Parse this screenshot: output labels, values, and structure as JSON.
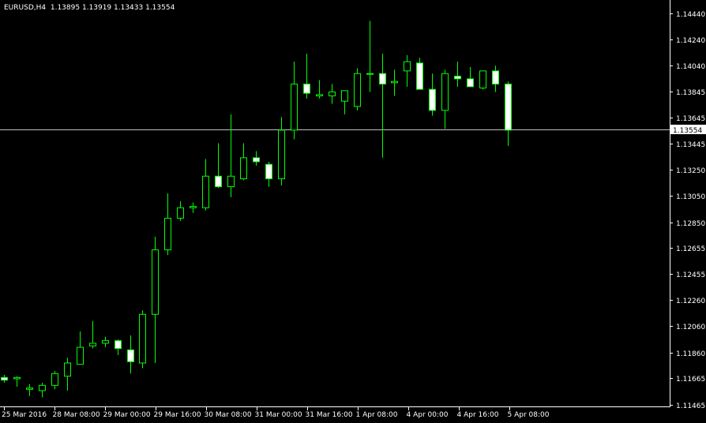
{
  "header": {
    "symbol": "EURUSD,H4",
    "ohlc": "1.13895 1.13919 1.13433 1.13554"
  },
  "current_price_label": "1.13554",
  "colors": {
    "background": "#000000",
    "frame": "#ffffff",
    "candle_outline": "#00ff00",
    "bull_body": "#000000",
    "bear_body": "#ffffff",
    "bid_line": "#c0c0c0",
    "text": "#ffffff"
  },
  "chart_data": {
    "type": "candlestick",
    "title": "EURUSD,H4",
    "xlabel": "",
    "ylabel": "",
    "ylim": [
      1.1146,
      1.1452
    ],
    "grid": false,
    "y_ticks": [
      "1.14440",
      "1.14240",
      "1.14040",
      "1.13845",
      "1.13645",
      "1.13445",
      "1.13250",
      "1.13050",
      "1.12850",
      "1.12655",
      "1.12455",
      "1.12260",
      "1.12060",
      "1.11860",
      "1.11665",
      "1.11465"
    ],
    "x_ticks": [
      "25 Mar 2016",
      "28 Mar 08:00",
      "29 Mar 00:00",
      "29 Mar 16:00",
      "30 Mar 08:00",
      "31 Mar 00:00",
      "31 Mar 16:00",
      "1 Apr 08:00",
      "4 Apr 00:00",
      "4 Apr 16:00",
      "5 Apr 08:00"
    ],
    "current_price": 1.13554,
    "candles": [
      {
        "o": 1.1167,
        "h": 1.1169,
        "l": 1.1163,
        "c": 1.1165
      },
      {
        "o": 1.1166,
        "h": 1.1168,
        "l": 1.116,
        "c": 1.1167
      },
      {
        "o": 1.1158,
        "h": 1.1162,
        "l": 1.1153,
        "c": 1.1159
      },
      {
        "o": 1.1157,
        "h": 1.1163,
        "l": 1.1152,
        "c": 1.1161
      },
      {
        "o": 1.1161,
        "h": 1.1172,
        "l": 1.1158,
        "c": 1.117
      },
      {
        "o": 1.1168,
        "h": 1.1182,
        "l": 1.1157,
        "c": 1.1178
      },
      {
        "o": 1.1177,
        "h": 1.1202,
        "l": 1.1177,
        "c": 1.119
      },
      {
        "o": 1.1191,
        "h": 1.121,
        "l": 1.1189,
        "c": 1.1193
      },
      {
        "o": 1.1193,
        "h": 1.1198,
        "l": 1.119,
        "c": 1.1195
      },
      {
        "o": 1.1195,
        "h": 1.1196,
        "l": 1.1184,
        "c": 1.1189
      },
      {
        "o": 1.1188,
        "h": 1.1199,
        "l": 1.117,
        "c": 1.1179
      },
      {
        "o": 1.1178,
        "h": 1.1218,
        "l": 1.1174,
        "c": 1.1215
      },
      {
        "o": 1.1215,
        "h": 1.1274,
        "l": 1.1178,
        "c": 1.1264
      },
      {
        "o": 1.1264,
        "h": 1.1307,
        "l": 1.126,
        "c": 1.1288
      },
      {
        "o": 1.1288,
        "h": 1.1301,
        "l": 1.1286,
        "c": 1.1296
      },
      {
        "o": 1.1296,
        "h": 1.13,
        "l": 1.1292,
        "c": 1.1297
      },
      {
        "o": 1.1296,
        "h": 1.1333,
        "l": 1.1294,
        "c": 1.132
      },
      {
        "o": 1.132,
        "h": 1.1345,
        "l": 1.1311,
        "c": 1.1312
      },
      {
        "o": 1.1312,
        "h": 1.1367,
        "l": 1.1304,
        "c": 1.132
      },
      {
        "o": 1.1318,
        "h": 1.1345,
        "l": 1.1317,
        "c": 1.1334
      },
      {
        "o": 1.1334,
        "h": 1.1339,
        "l": 1.1328,
        "c": 1.1331
      },
      {
        "o": 1.1329,
        "h": 1.1331,
        "l": 1.1312,
        "c": 1.1318
      },
      {
        "o": 1.1318,
        "h": 1.1365,
        "l": 1.1313,
        "c": 1.1355
      },
      {
        "o": 1.1355,
        "h": 1.1407,
        "l": 1.1348,
        "c": 1.139
      },
      {
        "o": 1.139,
        "h": 1.1413,
        "l": 1.1379,
        "c": 1.1383
      },
      {
        "o": 1.1381,
        "h": 1.1393,
        "l": 1.1379,
        "c": 1.1382
      },
      {
        "o": 1.1381,
        "h": 1.139,
        "l": 1.1375,
        "c": 1.1384
      },
      {
        "o": 1.1377,
        "h": 1.1385,
        "l": 1.1367,
        "c": 1.1385
      },
      {
        "o": 1.1373,
        "h": 1.1402,
        "l": 1.137,
        "c": 1.1398
      },
      {
        "o": 1.1398,
        "h": 1.1438,
        "l": 1.1384,
        "c": 1.1398
      },
      {
        "o": 1.1398,
        "h": 1.1413,
        "l": 1.1334,
        "c": 1.139
      },
      {
        "o": 1.1391,
        "h": 1.1401,
        "l": 1.1381,
        "c": 1.1392
      },
      {
        "o": 1.14,
        "h": 1.1412,
        "l": 1.1388,
        "c": 1.1407
      },
      {
        "o": 1.1406,
        "h": 1.141,
        "l": 1.1386,
        "c": 1.1386
      },
      {
        "o": 1.1386,
        "h": 1.1398,
        "l": 1.1366,
        "c": 1.137
      },
      {
        "o": 1.137,
        "h": 1.1401,
        "l": 1.1356,
        "c": 1.1398
      },
      {
        "o": 1.1396,
        "h": 1.1407,
        "l": 1.1388,
        "c": 1.1394
      },
      {
        "o": 1.1394,
        "h": 1.1403,
        "l": 1.1388,
        "c": 1.1388
      },
      {
        "o": 1.1387,
        "h": 1.14,
        "l": 1.1386,
        "c": 1.14
      },
      {
        "o": 1.14,
        "h": 1.1404,
        "l": 1.1384,
        "c": 1.139
      },
      {
        "o": 1.139,
        "h": 1.1392,
        "l": 1.1343,
        "c": 1.1355
      }
    ]
  }
}
